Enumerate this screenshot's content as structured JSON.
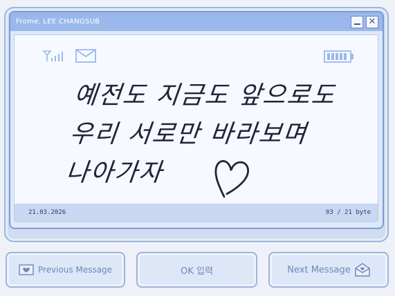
{
  "window": {
    "title": "Frome. LEE CHANGSUB"
  },
  "status": {
    "signal_icon": "signal-icon",
    "mail_icon": "envelope-icon",
    "battery_icon": "battery-icon"
  },
  "message": {
    "lines": [
      "예전도 지금도 앞으로도",
      "우리 서로만 바라보며",
      "나아가자"
    ]
  },
  "footer": {
    "date": "21.03.2026",
    "byte_count": "03 / 21 byte"
  },
  "buttons": {
    "previous": "Previous Message",
    "ok": "OK 입력",
    "next": "Next Message"
  },
  "colors": {
    "accent": "#9ab8ec",
    "border": "#7b9ad6",
    "text_muted": "#6f86b8"
  }
}
